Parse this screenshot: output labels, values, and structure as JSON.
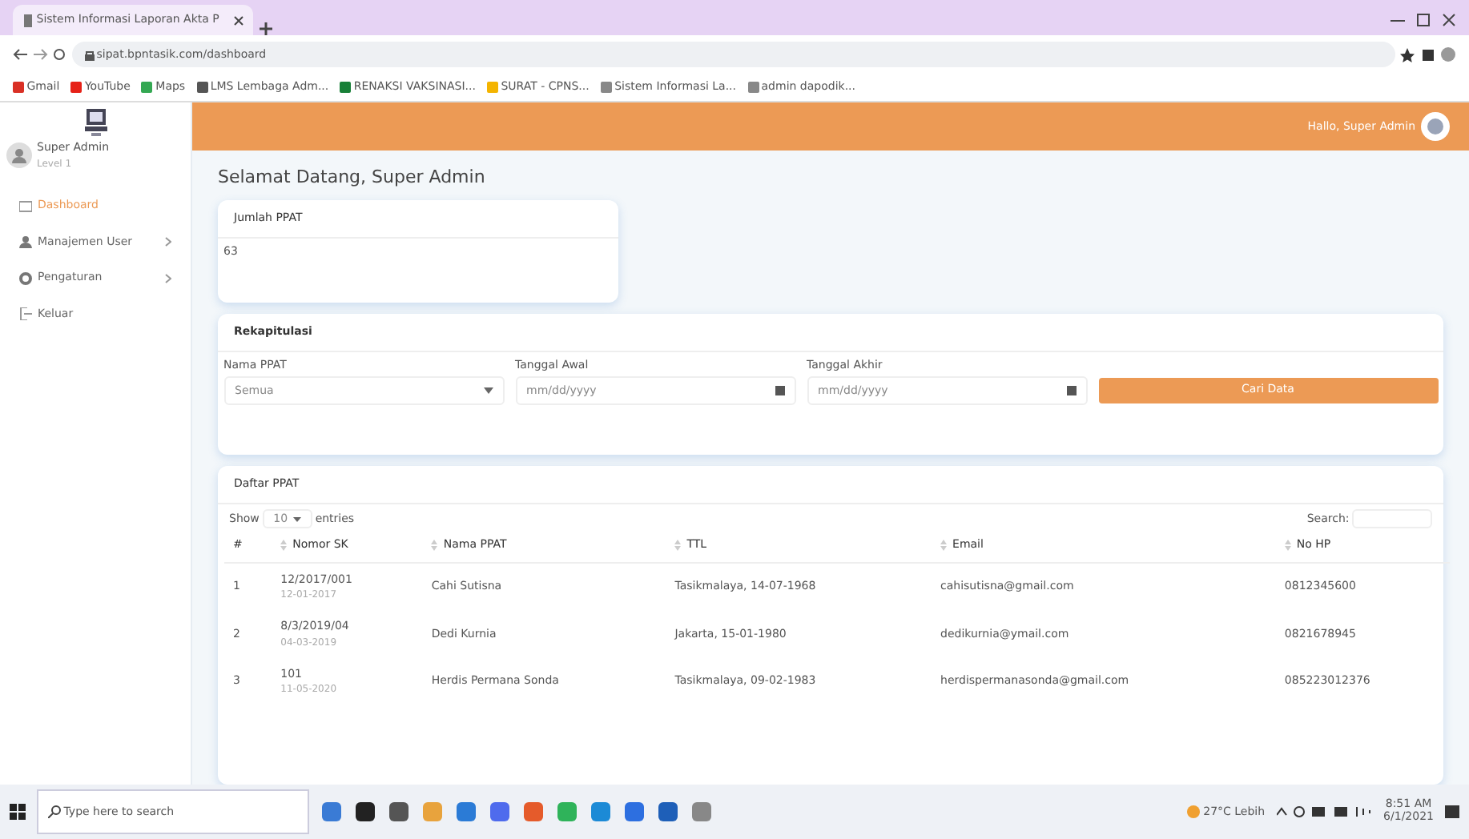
{
  "browser": {
    "tab_title": "Sistem Informasi Laporan Akta P",
    "url": "sipat.bpntasik.com/dashboard",
    "bookmarks": [
      "Gmail",
      "YouTube",
      "Maps",
      "LMS Lembaga Adm...",
      "RENAKSI VAKSINASI...",
      "SURAT - CPNS...",
      "Sistem Informasi La...",
      "admin dapodik..."
    ]
  },
  "header": {
    "user_name": "Hallo, Super Admin"
  },
  "sidebar": {
    "user_name": "Super Admin",
    "user_level": "Level 1",
    "items": [
      {
        "label": "Dashboard",
        "selected": true,
        "has_submenu": false
      },
      {
        "label": "Manajemen User",
        "selected": false,
        "has_submenu": true
      },
      {
        "label": "Pengaturan",
        "selected": false,
        "has_submenu": true
      },
      {
        "label": "Keluar",
        "selected": false,
        "has_submenu": false
      }
    ]
  },
  "page_title": "Selamat Datang, Super Admin",
  "stat_card": {
    "label": "Jumlah PPAT",
    "value": "63"
  },
  "filter": {
    "title": "Rekapitulasi",
    "fields": [
      {
        "kind": "select",
        "label": "Nama PPAT",
        "value": "Semua"
      },
      {
        "kind": "date",
        "label": "Tanggal Awal",
        "placeholder": "mm/dd/yyyy"
      },
      {
        "kind": "date",
        "label": "Tanggal Akhir",
        "placeholder": "mm/dd/yyyy"
      }
    ],
    "button": "Cari Data"
  },
  "table": {
    "title": "Daftar PPAT",
    "show_label": "Show",
    "page_size": "10",
    "entries_label": "entries",
    "search_label": "Search:",
    "columns": [
      "#",
      "Nomor SK",
      "Nama PPAT",
      "TTL",
      "Email",
      "No HP"
    ],
    "rows": [
      {
        "cells": [
          "1",
          "12/2017/001",
          "Cahi Sutisna",
          "Tasikmalaya, 14-07-1968",
          "cahisutisna@gmail.com",
          "0812345600"
        ],
        "sk_date": "12-01-2017"
      },
      {
        "cells": [
          "2",
          "8/3/2019/04",
          "Dedi Kurnia",
          "Jakarta, 15-01-1980",
          "dedikurnia@ymail.com",
          "0821678945"
        ],
        "sk_date": "04-03-2019"
      },
      {
        "cells": [
          "3",
          "101",
          "Herdis Permana Sonda",
          "Tasikmalaya, 09-02-1983",
          "herdispermanasonda@gmail.com",
          "085223012376"
        ],
        "sk_date": "11-05-2020"
      }
    ]
  },
  "taskbar": {
    "search_placeholder": "Type here to search",
    "weather": "27°C Lebih",
    "time": "8:51 AM",
    "date": "6/1/2021"
  }
}
